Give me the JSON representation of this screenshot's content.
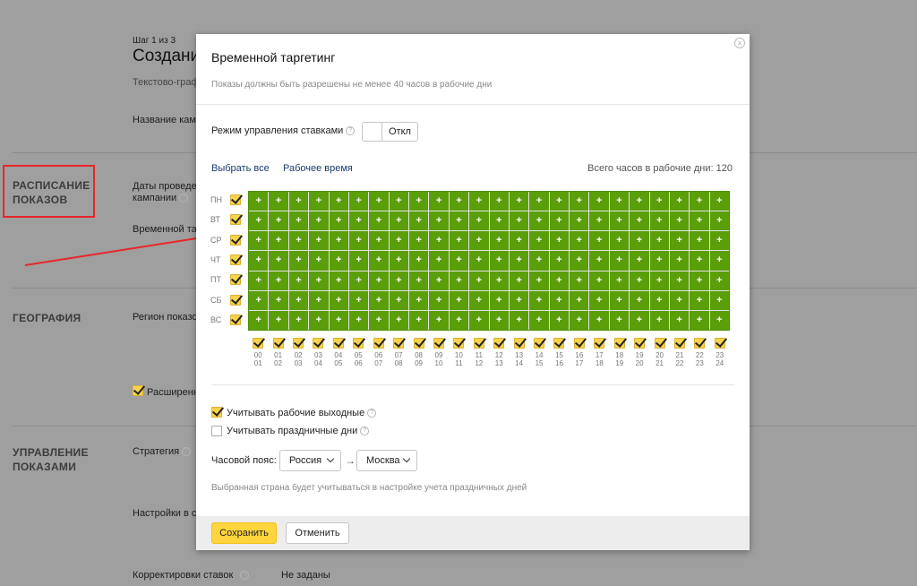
{
  "background": {
    "step": "Шаг 1 из 3",
    "title": "Создани",
    "subtitle": "Текстово-граф",
    "campaign_name_label": "Название камп",
    "sections": {
      "schedule": [
        "РАСПИСАНИЕ",
        "ПОКАЗОВ"
      ],
      "geography": "ГЕОГРАФИЯ",
      "management": [
        "УПРАВЛЕНИЕ",
        "ПОКАЗАМИ"
      ]
    },
    "dates_label": [
      "Даты проведе",
      "кампании"
    ],
    "time_targeting_label": "Временной та",
    "region_label": "Регион показо",
    "extended_label": "Расширенн",
    "strategy_label": "Стратегия",
    "settings_label": "Настройки в се",
    "bid_adjustments_label": "Корректировки ставок",
    "bid_adjustments_value": "Не заданы"
  },
  "modal": {
    "title": "Временной таргетинг",
    "subtitle": "Показы должны быть разрешены не менее 40 часов в рабочие дни",
    "bid_mode_label": "Режим управления ставками",
    "bid_mode_value": "Откл",
    "select_all": "Выбрать все",
    "work_time": "Рабочее время",
    "total_hours": "Всего часов в рабочие дни: 120",
    "days": [
      "ПН",
      "ВТ",
      "СР",
      "ЧТ",
      "ПТ",
      "СБ",
      "ВС"
    ],
    "hours_top": [
      "00",
      "01",
      "02",
      "03",
      "04",
      "05",
      "06",
      "07",
      "08",
      "09",
      "10",
      "11",
      "12",
      "13",
      "14",
      "15",
      "16",
      "17",
      "18",
      "19",
      "20",
      "21",
      "22",
      "23"
    ],
    "hours_bottom": [
      "01",
      "02",
      "03",
      "04",
      "05",
      "06",
      "07",
      "08",
      "09",
      "10",
      "11",
      "12",
      "13",
      "14",
      "15",
      "16",
      "17",
      "18",
      "19",
      "20",
      "21",
      "22",
      "23",
      "24"
    ],
    "cell_symbol": "+",
    "consider_workdays": "Учитывать рабочие выходные",
    "consider_holidays": "Учитывать праздничные дни",
    "timezone_label": "Часовой пояс:",
    "country": "Россия",
    "city": "Москва",
    "arrow": "→",
    "note": "Выбранная страна будет учитываться в настройке учета праздничных дней",
    "save": "Сохранить",
    "cancel": "Отменить",
    "close_symbol": "×"
  },
  "colors": {
    "cell_green": "#5a9e0a",
    "checkbox_yellow": "#f7d34d",
    "save_yellow": "#fed53c",
    "annotation_red": "#e8262a"
  }
}
